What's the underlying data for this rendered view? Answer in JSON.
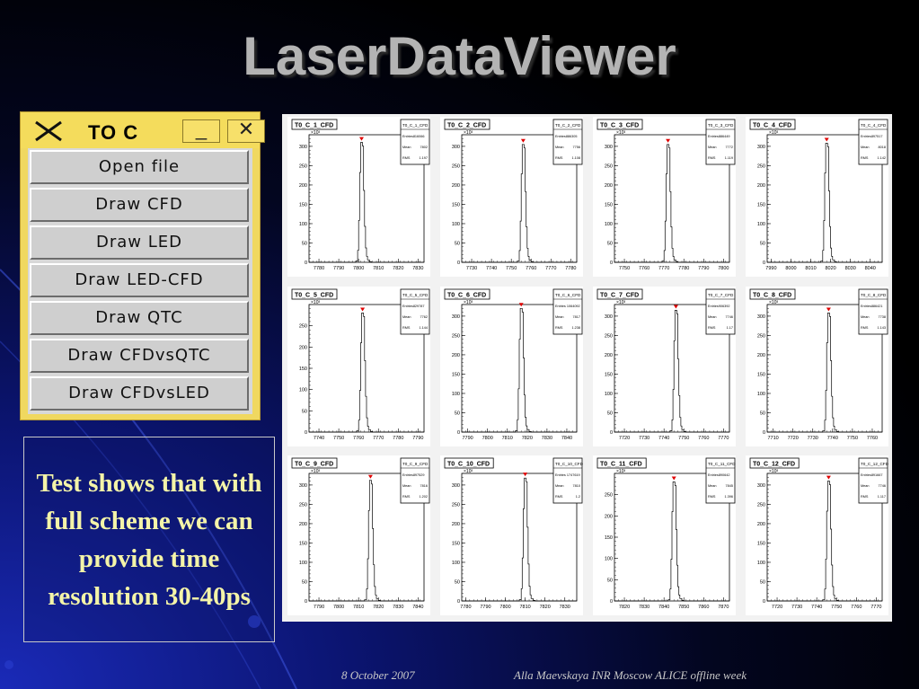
{
  "slide": {
    "title": "LaserDataViewer",
    "note": "Test shows that with full scheme we can provide time resolution 30-40ps",
    "footer_date": "8 October 2007",
    "footer_author": "Alla Maevskaya INR Moscow     ALICE offline week"
  },
  "panel": {
    "title": "TO C",
    "minimize_label": "_",
    "close_label": "✕",
    "buttons": [
      {
        "label": "Open file"
      },
      {
        "label": "Draw CFD"
      },
      {
        "label": "Draw LED"
      },
      {
        "label": "Draw LED-CFD"
      },
      {
        "label": "Draw QTC"
      },
      {
        "label": "Draw CFDvsQTC"
      },
      {
        "label": "Draw CFDvsLED"
      }
    ]
  },
  "colors": {
    "marker": "#e00000",
    "note_text": "#f4f4a8",
    "title": "#b4b4b4"
  },
  "chart_data": [
    {
      "type": "bar",
      "title": "T0_C_1_CFD",
      "stats_title": "T0_C_1_CFD",
      "entries": "Entries816066",
      "mean": "7802",
      "rms": "1.197",
      "y_exponent": "×10³",
      "xticks": [
        "7780",
        "7790",
        "7800",
        "7810",
        "7820",
        "7830"
      ],
      "xlim": [
        7775,
        7833
      ],
      "ylim": [
        0,
        330
      ],
      "yticks": [
        0,
        50,
        100,
        150,
        200,
        250,
        300
      ],
      "peak_x": 7801.5,
      "peak_y": 310
    },
    {
      "type": "bar",
      "title": "T0_C_2_CFD",
      "stats_title": "T0_C_2_CFD",
      "entries": "Entries886305",
      "mean": "7756",
      "rms": "1.108",
      "y_exponent": "×10³",
      "xticks": [
        "7730",
        "7740",
        "7750",
        "7760",
        "7770",
        "7780"
      ],
      "xlim": [
        7725,
        7783
      ],
      "ylim": [
        0,
        330
      ],
      "yticks": [
        0,
        50,
        100,
        150,
        200,
        250,
        300
      ],
      "peak_x": 7756,
      "peak_y": 305
    },
    {
      "type": "bar",
      "title": "T0_C_3_CFD",
      "stats_title": "T0_C_3_CFD",
      "entries": "Entries886449",
      "mean": "7772",
      "rms": "1.119",
      "y_exponent": "×10³",
      "xticks": [
        "7750",
        "7760",
        "7770",
        "7780",
        "7790",
        "7800"
      ],
      "xlim": [
        7745,
        7803
      ],
      "ylim": [
        0,
        330
      ],
      "yticks": [
        0,
        50,
        100,
        150,
        200,
        250,
        300
      ],
      "peak_x": 7772,
      "peak_y": 305
    },
    {
      "type": "bar",
      "title": "T0_C_4_CFD",
      "stats_title": "T0_C_4_CFD",
      "entries": "Entries897517",
      "mean": "8018",
      "rms": "1.142",
      "y_exponent": "×10³",
      "xticks": [
        "7990",
        "8000",
        "8010",
        "8020",
        "8030",
        "8040"
      ],
      "xlim": [
        7988,
        8046
      ],
      "ylim": [
        0,
        330
      ],
      "yticks": [
        0,
        50,
        100,
        150,
        200,
        250,
        300
      ],
      "peak_x": 8018,
      "peak_y": 308
    },
    {
      "type": "bar",
      "title": "T0_C_5_CFD",
      "stats_title": "T0_C_5_CFD",
      "entries": "Entries829787",
      "mean": "7762",
      "rms": "1.144",
      "y_exponent": "×10³",
      "xticks": [
        "7740",
        "7750",
        "7760",
        "7770",
        "7780",
        "7790"
      ],
      "xlim": [
        7735,
        7793
      ],
      "ylim": [
        0,
        300
      ],
      "yticks": [
        0,
        50,
        100,
        150,
        200,
        250
      ],
      "peak_x": 7762,
      "peak_y": 280
    },
    {
      "type": "bar",
      "title": "T0_C_6_CFD",
      "stats_title": "T0_C_6_CFD",
      "entries": "Entries 1064092",
      "mean": "7817",
      "rms": "1.238",
      "y_exponent": "×10³",
      "xticks": [
        "7790",
        "7800",
        "7810",
        "7820",
        "7830",
        "7840"
      ],
      "xlim": [
        7787,
        7845
      ],
      "ylim": [
        0,
        330
      ],
      "yticks": [
        0,
        50,
        100,
        150,
        200,
        250,
        300
      ],
      "peak_x": 7817,
      "peak_y": 320
    },
    {
      "type": "bar",
      "title": "T0_C_7_CFD",
      "stats_title": "T0_C_7_CFD",
      "entries": "Entries906392",
      "mean": "7746",
      "rms": "1.17",
      "y_exponent": "×10³",
      "xticks": [
        "7720",
        "7730",
        "7740",
        "7750",
        "7760",
        "7770"
      ],
      "xlim": [
        7715,
        7773
      ],
      "ylim": [
        0,
        330
      ],
      "yticks": [
        0,
        50,
        100,
        150,
        200,
        250,
        300
      ],
      "peak_x": 7746,
      "peak_y": 315
    },
    {
      "type": "bar",
      "title": "T0_C_8_CFD",
      "stats_title": "T0_C_8_CFD",
      "entries": "Entries886421",
      "mean": "7738",
      "rms": "1.143",
      "y_exponent": "×10³",
      "xticks": [
        "7710",
        "7720",
        "7730",
        "7740",
        "7750",
        "7760"
      ],
      "xlim": [
        7707,
        7765
      ],
      "ylim": [
        0,
        330
      ],
      "yticks": [
        0,
        50,
        100,
        150,
        200,
        250,
        300
      ],
      "peak_x": 7738,
      "peak_y": 308
    },
    {
      "type": "bar",
      "title": "T0_C_9_CFD",
      "stats_title": "T0_C_9_CFD",
      "entries": "Entries897529",
      "mean": "7816",
      "rms": "1.202",
      "y_exponent": "×10³",
      "xticks": [
        "7790",
        "7800",
        "7810",
        "7820",
        "7830",
        "7840"
      ],
      "xlim": [
        7785,
        7843
      ],
      "ylim": [
        0,
        330
      ],
      "yticks": [
        0,
        50,
        100,
        150,
        200,
        250,
        300
      ],
      "peak_x": 7816,
      "peak_y": 312
    },
    {
      "type": "bar",
      "title": "T0_C_10_CFD",
      "stats_title": "T0_C_10_CFD",
      "entries": "Entries 1747619",
      "mean": "7810",
      "rms": "1.2",
      "y_exponent": "×10³",
      "xticks": [
        "7780",
        "7790",
        "7800",
        "7810",
        "7820",
        "7830"
      ],
      "xlim": [
        7778,
        7836
      ],
      "ylim": [
        0,
        330
      ],
      "yticks": [
        0,
        50,
        100,
        150,
        200,
        250,
        300
      ],
      "peak_x": 7810,
      "peak_y": 318
    },
    {
      "type": "bar",
      "title": "T0_C_11_CFD",
      "stats_title": "T0_C_11_CFD",
      "entries": "Entries890642",
      "mean": "7845",
      "rms": "1.396",
      "y_exponent": "×10³",
      "xticks": [
        "7820",
        "7830",
        "7840",
        "7850",
        "7860",
        "7870"
      ],
      "xlim": [
        7815,
        7873
      ],
      "ylim": [
        0,
        300
      ],
      "yticks": [
        0,
        50,
        100,
        150,
        200,
        250
      ],
      "peak_x": 7845,
      "peak_y": 280
    },
    {
      "type": "bar",
      "title": "T0_C_12_CFD",
      "stats_title": "T0_C_12_CFD",
      "entries": "Entries891667",
      "mean": "7746",
      "rms": "1.117",
      "y_exponent": "×10³",
      "xticks": [
        "7720",
        "7730",
        "7740",
        "7750",
        "7760",
        "7770"
      ],
      "xlim": [
        7715,
        7773
      ],
      "ylim": [
        0,
        330
      ],
      "yticks": [
        0,
        50,
        100,
        150,
        200,
        250,
        300
      ],
      "peak_x": 7746,
      "peak_y": 310
    }
  ]
}
